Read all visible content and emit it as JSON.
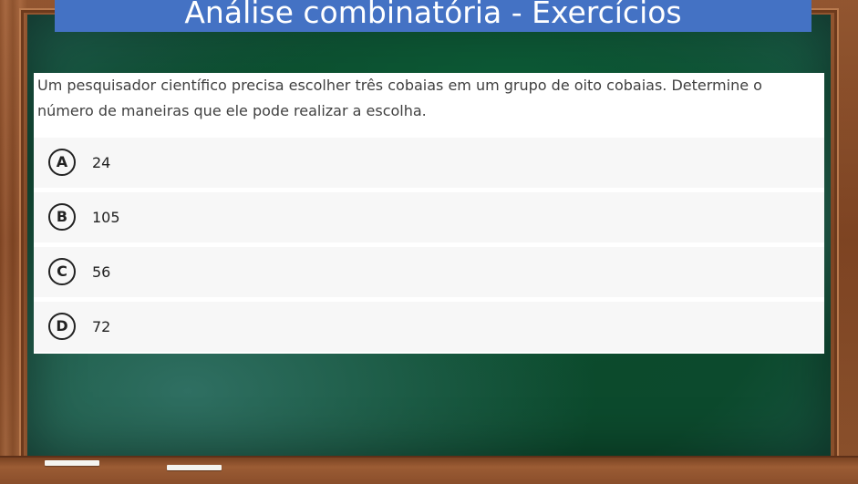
{
  "slide": {
    "title": "Análise combinatória - Exercícios"
  },
  "quiz": {
    "question": "Um pesquisador científico precisa escolher três cobaias em um grupo de oito cobaias. Determine o número de maneiras que ele pode realizar a escolha.",
    "options": [
      {
        "letter": "A",
        "text": "24"
      },
      {
        "letter": "B",
        "text": "105"
      },
      {
        "letter": "C",
        "text": "56"
      },
      {
        "letter": "D",
        "text": "72"
      }
    ]
  },
  "colors": {
    "banner": "#4472c4",
    "board": "#0c4a2d",
    "frame": "#8b4b26",
    "option_background": "#f7f7f7"
  }
}
